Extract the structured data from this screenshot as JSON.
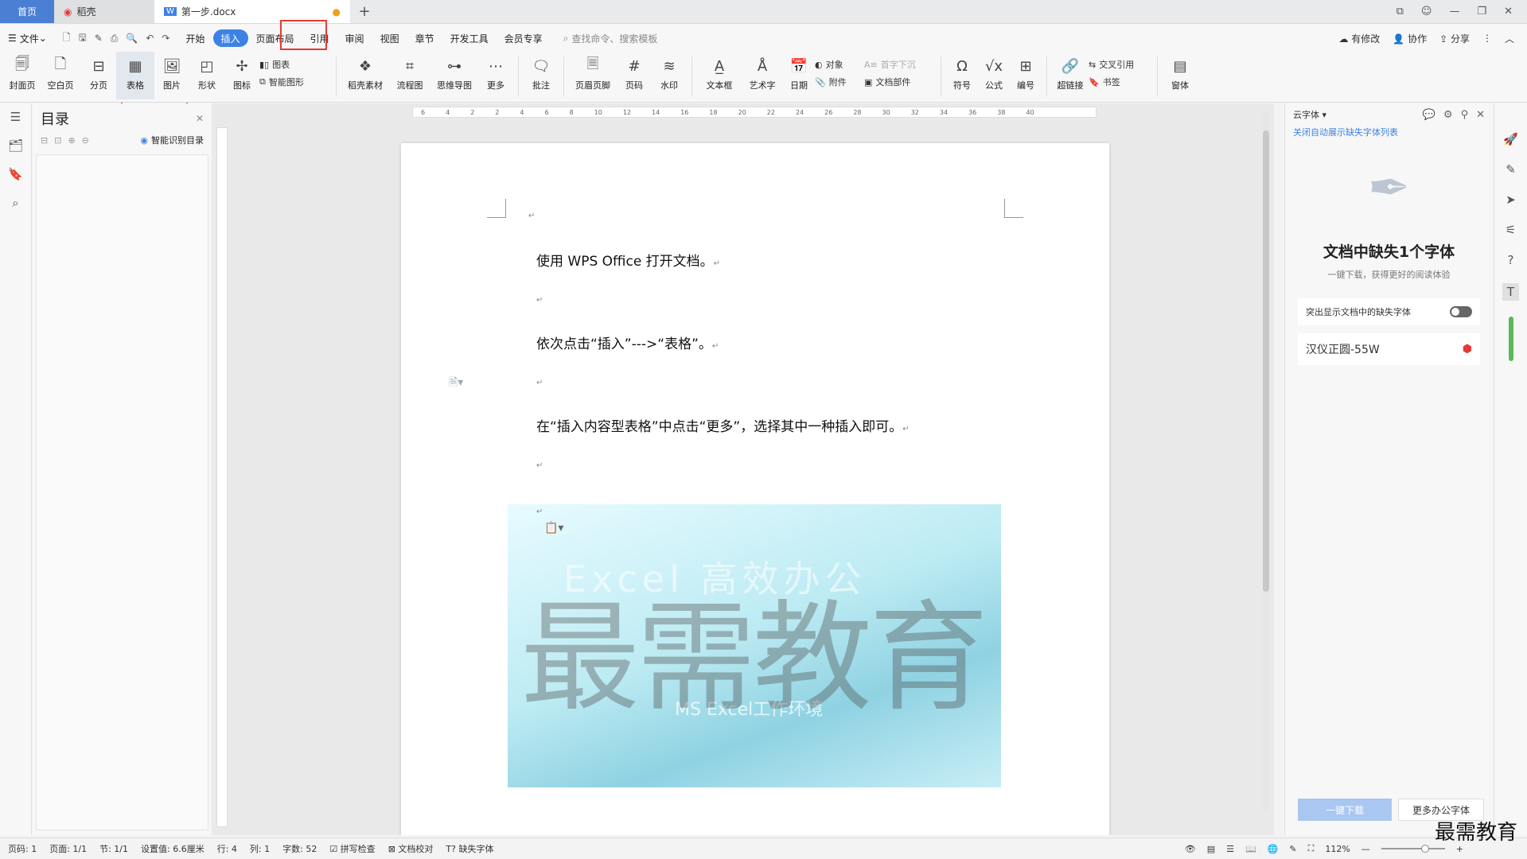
{
  "tabs": {
    "home": "首页",
    "daoke": "稻壳",
    "doc": "第一步.docx"
  },
  "menu": {
    "file": "文件",
    "items": [
      "开始",
      "插入",
      "页面布局",
      "引用",
      "审阅",
      "视图",
      "章节",
      "开发工具",
      "会员专享"
    ],
    "search": "查找命令、搜索模板",
    "right": [
      "有修改",
      "协作",
      "分享"
    ]
  },
  "ribbon": {
    "big": [
      "封面页",
      "空白页",
      "分页",
      "表格",
      "图片",
      "形状",
      "图标"
    ],
    "chart": "图表",
    "smart": "智能图形",
    "big2": [
      "稻壳素材",
      "流程图",
      "思维导图",
      "更多",
      "批注",
      "页眉页脚",
      "页码",
      "水印",
      "文本框",
      "艺术字",
      "日期"
    ],
    "obj": "对象",
    "attach": "附件",
    "dropcap": "首字下沉",
    "docpart": "文档部件",
    "big3": [
      "符号",
      "公式",
      "编号",
      "超链接"
    ],
    "crossref": "交叉引用",
    "bookmark": "书签",
    "window": "窗体"
  },
  "toc": {
    "title": "目录",
    "smart": "智能识别目录"
  },
  "doc": {
    "p1": "使用 WPS Office 打开文档。",
    "p2": "依次点击“插入”--->“表格”。",
    "p3": "在“插入内容型表格”中点击“更多”，选择其中一种插入即可。",
    "img_wm1": "Excel 高效办公",
    "img_wm2": "MS Excel工作环境",
    "watermark": "最需教育"
  },
  "right": {
    "title": "云字体",
    "link": "关闭自动展示缺失字体列表",
    "heading": "文档中缺失1个字体",
    "sub": "一键下载，获得更好的阅读体验",
    "toggle": "突出显示文档中的缺失字体",
    "font": "汉仪正圆-55W",
    "btn1": "一键下载",
    "btn2": "更多办公字体"
  },
  "status": {
    "page": "页码: 1",
    "pages": "页面: 1/1",
    "section": "节: 1/1",
    "setting": "设置值: 6.6厘米",
    "row": "行: 4",
    "col": "列: 1",
    "words": "字数: 52",
    "spell": "拼写检查",
    "proof": "文档校对",
    "missing": "缺失字体",
    "zoom": "112%"
  },
  "brand": "最需教育"
}
